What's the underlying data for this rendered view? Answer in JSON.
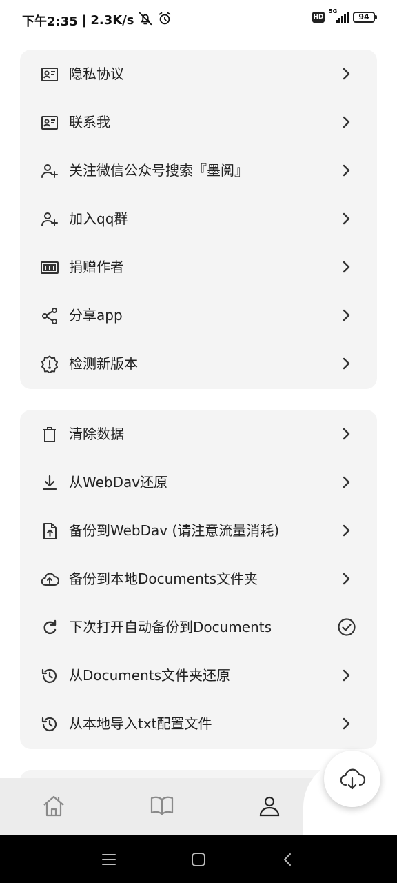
{
  "status_bar": {
    "time": "下午2:35",
    "speed": "2.3K/s",
    "network": "5G",
    "battery": "94",
    "hd": "HD"
  },
  "card_about": {
    "items": [
      {
        "label": "隐私协议",
        "icon": "id-card-icon"
      },
      {
        "label": "联系我",
        "icon": "id-card-icon"
      },
      {
        "label": "关注微信公众号搜索『墨阅』",
        "icon": "add-user-icon"
      },
      {
        "label": "加入qq群",
        "icon": "add-user-icon"
      },
      {
        "label": "捐赠作者",
        "icon": "donate-icon"
      },
      {
        "label": "分享app",
        "icon": "share-icon"
      },
      {
        "label": "检测新版本",
        "icon": "update-badge-icon"
      }
    ]
  },
  "card_backup": {
    "items": [
      {
        "label": "清除数据",
        "icon": "trash-icon"
      },
      {
        "label": "从WebDav还原",
        "icon": "download-icon"
      },
      {
        "label": "备份到WebDav (请注意流量消耗)",
        "icon": "file-upload-icon"
      },
      {
        "label": "备份到本地Documents文件夹",
        "icon": "cloud-upload-icon"
      },
      {
        "label": "下次打开自动备份到Documents",
        "icon": "refresh-icon",
        "checked": true
      },
      {
        "label": "从Documents文件夹还原",
        "icon": "history-icon"
      },
      {
        "label": "从本地导入txt配置文件",
        "icon": "history-icon"
      }
    ]
  },
  "bottom_nav": {
    "items": [
      "home-icon",
      "book-icon",
      "user-icon"
    ],
    "active": "user-icon"
  },
  "fab": {
    "icon": "cloud-download-icon"
  },
  "colors": {
    "card": "#f4f4f4",
    "nav": "#ececec",
    "text": "#222222",
    "icon": "#333333"
  }
}
